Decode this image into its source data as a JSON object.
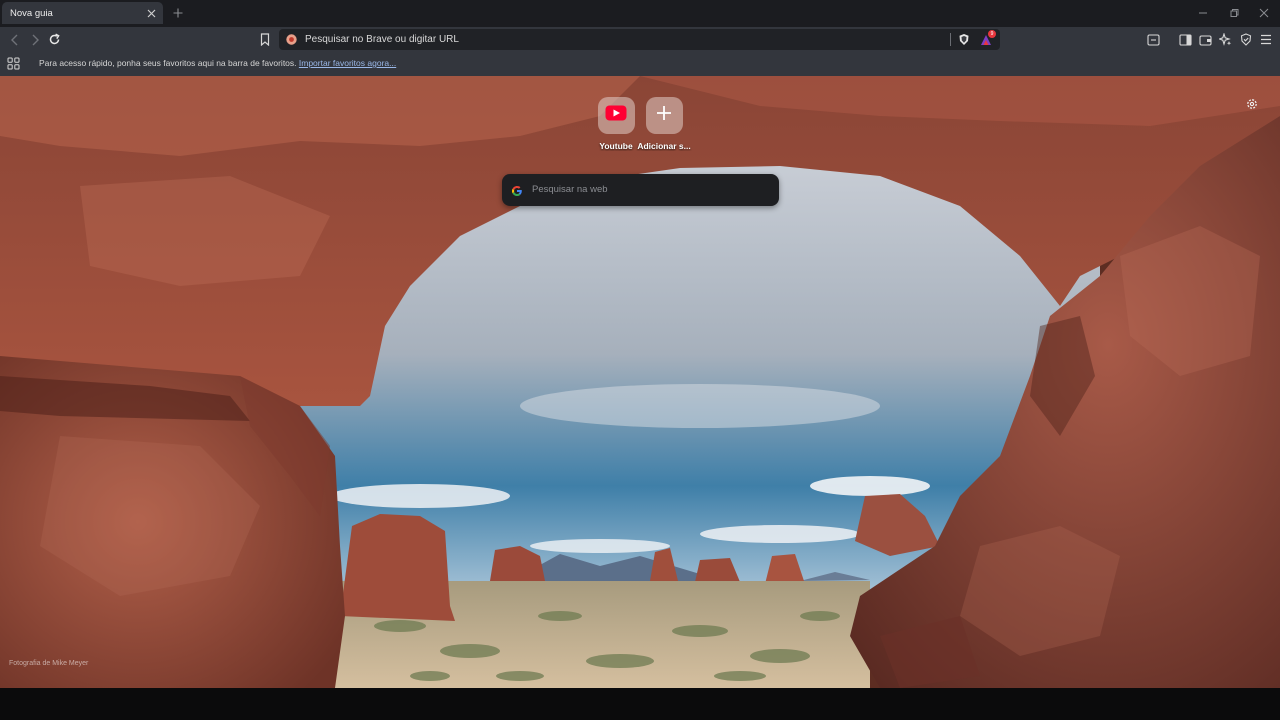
{
  "tab": {
    "title": "Nova guia"
  },
  "toolbar": {
    "url_placeholder": "Pesquisar no Brave ou digitar URL",
    "rewards_count": "9"
  },
  "bookmarks_bar": {
    "message": "Para acesso rápido, ponha seus favoritos aqui na barra de favoritos.",
    "import_link": "Importar favoritos agora..."
  },
  "new_tab": {
    "top_sites": [
      {
        "label": "Youtube",
        "icon": "youtube-icon"
      },
      {
        "label": "Adicionar s...",
        "icon": "plus-icon"
      }
    ],
    "search_placeholder": "Pesquisar na web",
    "photo_credit": "Fotografia de Mike Meyer"
  },
  "colors": {
    "tab_strip": "#1b1c20",
    "toolbar": "#33363d",
    "url_bar": "#202226",
    "search_box": "#1e1f22",
    "youtube_red": "#ff0033",
    "rewards_accent": "#e8363d"
  }
}
